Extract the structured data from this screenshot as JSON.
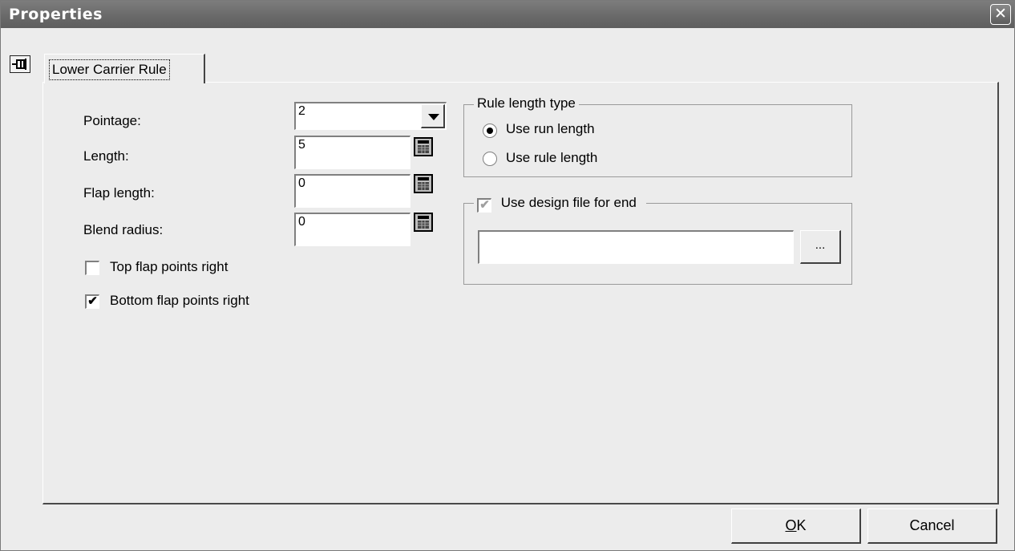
{
  "window": {
    "title": "Properties"
  },
  "tab": {
    "label": "Lower Carrier Rule"
  },
  "fields": {
    "pointage": {
      "label": "Pointage:",
      "value": "2"
    },
    "length": {
      "label": "Length:",
      "value": "5"
    },
    "flap_length": {
      "label": "Flap length:",
      "value": "0"
    },
    "blend_radius": {
      "label": "Blend radius:",
      "value": "0"
    }
  },
  "checkboxes": {
    "top_flap": {
      "label": "Top flap points right",
      "checked": false
    },
    "bottom_flap": {
      "label": "Bottom flap points right",
      "checked": true,
      "mark": "✔"
    }
  },
  "rule_length_type": {
    "legend": "Rule length type",
    "options": [
      {
        "label": "Use run length",
        "selected": true
      },
      {
        "label": "Use rule length",
        "selected": false
      }
    ]
  },
  "design_file": {
    "label": "Use design file for end",
    "checked": true,
    "mark": "✔",
    "path_value": "",
    "browse_label": "..."
  },
  "buttons": {
    "ok": "OK",
    "ok_mnemonic": "O",
    "ok_rest": "K",
    "cancel": "Cancel"
  },
  "colors": {
    "titlebar": "#6a6a6a",
    "dialog": "#ececec"
  }
}
